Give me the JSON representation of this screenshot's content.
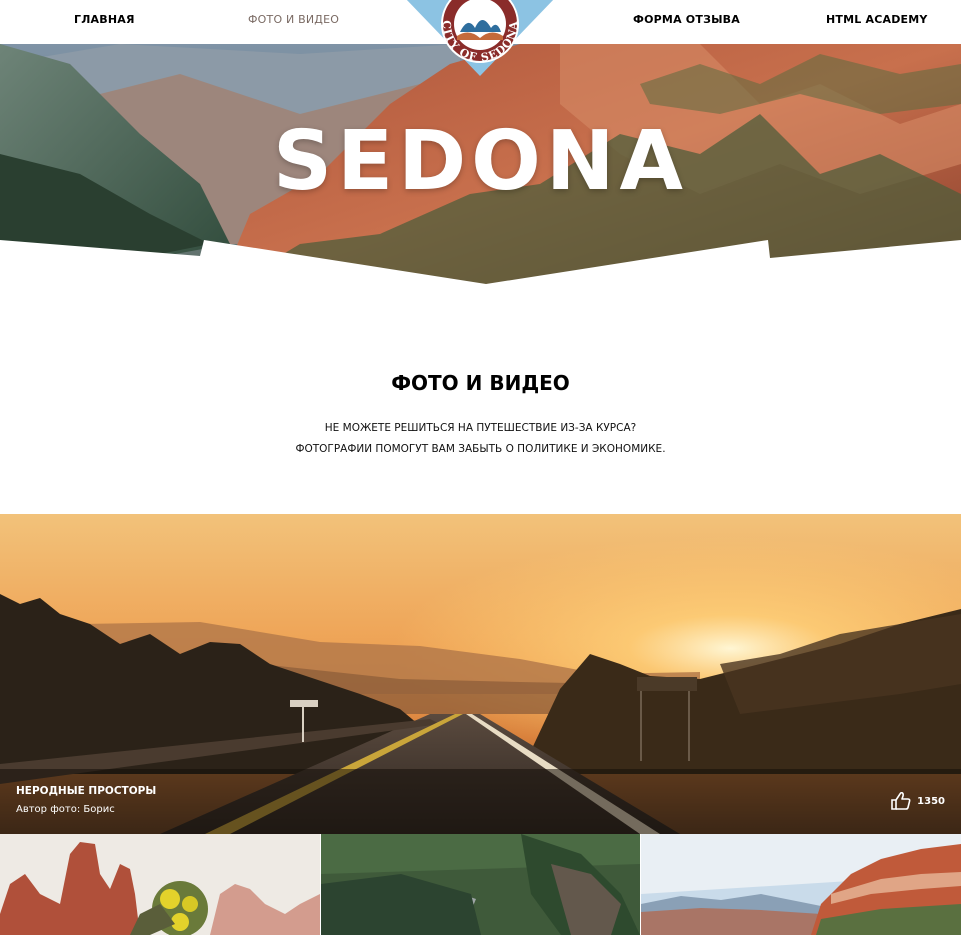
{
  "nav": {
    "items": [
      {
        "label": "ГЛАВНАЯ",
        "active": false
      },
      {
        "label": "ФОТО И ВИДЕО",
        "active": true
      },
      {
        "label": "ФОРМА ОТЗЫВА",
        "active": false
      },
      {
        "label": "HTML ACADEMY",
        "active": false
      }
    ]
  },
  "logo": {
    "text": "CITY OF SEDONA"
  },
  "hero": {
    "title": "SEDONA"
  },
  "intro": {
    "title": "ФОТО И ВИДЕО",
    "line1": "НЕ МОЖЕТЕ РЕШИТЬСЯ НА ПУТЕШЕСТВИЕ ИЗ-ЗА КУРСА?",
    "line2": "ФОТОГРАФИИ ПОМОГУТ ВАМ ЗАБЫТЬ О ПОЛИТИКЕ И ЭКОНОМИКЕ."
  },
  "featured": {
    "title": "НЕРОДНЫЕ ПРОСТОРЫ",
    "author": "Автор фото: Борис",
    "likes": "1350",
    "like_icon": "thumbs-up-icon"
  },
  "colors": {
    "logo_blue": "#8cc3e3",
    "logo_red": "#8a2c2a",
    "nav_active": "#7a6a63"
  }
}
